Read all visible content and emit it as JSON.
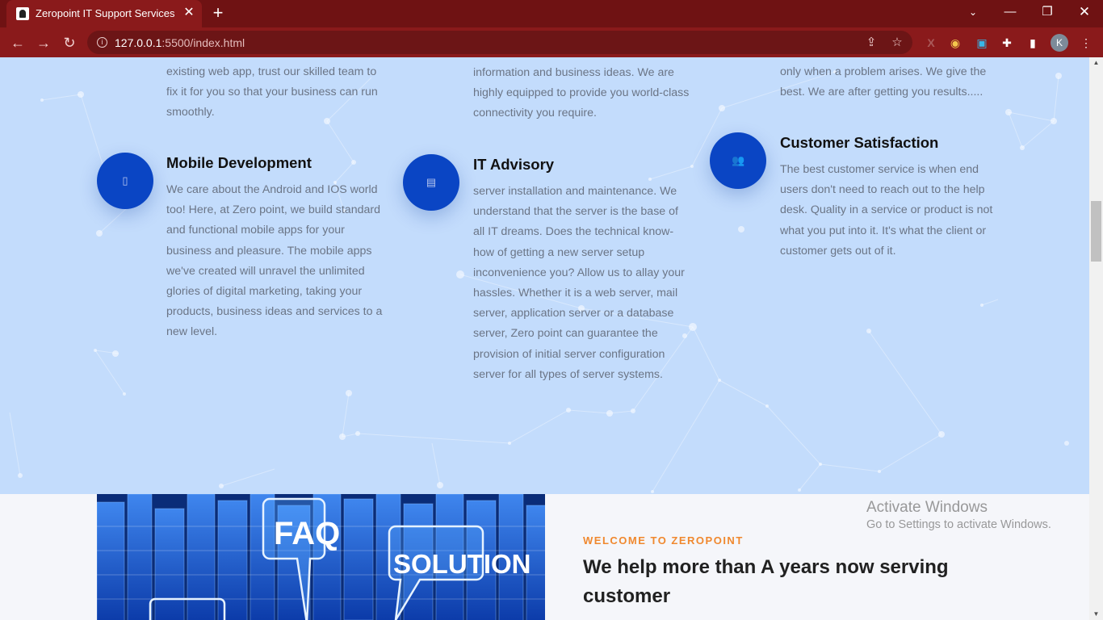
{
  "browser": {
    "tab_title": "Zeropoint IT Support Services",
    "url_host": "127.0.0.1",
    "url_rest": ":5500/index.html",
    "profile_initial": "K"
  },
  "services": {
    "col1_top_lines": [
      "existing web app, trust our skilled team to",
      "fix it for you so that your business can run",
      "smoothly."
    ],
    "col2_top_lines": [
      "information and business ideas. We are",
      "highly equipped to provide you world-class",
      "connectivity you require."
    ],
    "col3_top_lines": [
      "only when a problem arises. We give the",
      "best. We are after getting you results....."
    ],
    "items": [
      {
        "title": "Mobile Development",
        "icon": "mobile-phone-icon",
        "lines": [
          "We care about the Android and IOS world",
          "too! Here, at Zero point, we build standard",
          "and functional mobile apps for your",
          "business and pleasure. The mobile apps",
          "we've created will unravel the unlimited",
          "glories of digital marketing, taking your",
          "products, business ideas and services to a",
          "new level."
        ]
      },
      {
        "title": "IT Advisory",
        "icon": "book-icon",
        "lines": [
          "server installation and maintenance. We",
          "understand that the server is the base of",
          "all IT dreams. Does the technical know-",
          "how of getting a new server setup",
          "inconvenience you? Allow us to allay your",
          "hassles. Whether it is a web server, mail",
          "server, application server or a database",
          "server, Zero point can guarantee the",
          "provision of initial server configuration",
          "server for all types of server systems."
        ]
      },
      {
        "title": "Customer Satisfaction",
        "icon": "users-icon",
        "lines": [
          "The best customer service is when end",
          "users don't need to reach out to the help",
          "desk. Quality in a service or product is not",
          "what you put into it. It's what the client or",
          "customer gets out of it."
        ]
      }
    ]
  },
  "about": {
    "kicker": "WELCOME TO ZEROPOINT",
    "headline": "We help more than A years now serving customer",
    "image_bubble_1": "FAQ",
    "image_bubble_2": "SOLUTION"
  },
  "watermark": {
    "line1": "Activate Windows",
    "line2": "Go to Settings to activate Windows."
  },
  "colors": {
    "chrome": "#6f1213",
    "section_bg": "#c3dcfc",
    "icon_circle": "#0a45c4",
    "kicker": "#f0882e"
  }
}
